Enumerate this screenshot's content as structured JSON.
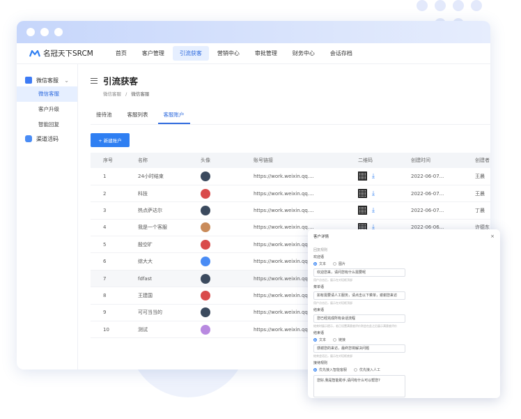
{
  "colors": {
    "accent": "#2f7ff2",
    "nav_active_bg": "#e6efff",
    "titlebar": "#c6d6fb"
  },
  "app": {
    "logo_text": "名冠天下SRCM"
  },
  "topnav": [
    {
      "label": "首页"
    },
    {
      "label": "客户管理"
    },
    {
      "label": "引流获客",
      "active": true
    },
    {
      "label": "营销中心"
    },
    {
      "label": "审批管理"
    },
    {
      "label": "财务中心"
    },
    {
      "label": "会话存档"
    }
  ],
  "sidebar": {
    "group1": {
      "label": "微信客服",
      "icon": "chat-icon"
    },
    "items": [
      {
        "label": "微信客服",
        "active": true
      },
      {
        "label": "客户升级"
      },
      {
        "label": "智能回复"
      }
    ],
    "group2": {
      "label": "渠道活码",
      "icon": "person-icon"
    }
  },
  "page": {
    "title": "引流获客",
    "breadcrumb": {
      "root": "微信客服",
      "sep": "/",
      "current": "微信客服"
    },
    "tabs": [
      {
        "label": "接待池"
      },
      {
        "label": "客服列表"
      },
      {
        "label": "客服账户",
        "active": true
      }
    ],
    "add_button": "+ 新建账户"
  },
  "table": {
    "headers": [
      "序号",
      "名称",
      "头像",
      "账号链接",
      "二维码",
      "创建时间",
      "创建者"
    ],
    "rows": [
      {
        "no": "1",
        "name": "24小时结束",
        "avatar": "#3b4a5e",
        "link": "https://work.weixin.qq....",
        "created": "2022-06-07...",
        "creator": "王晨"
      },
      {
        "no": "2",
        "name": "科技",
        "avatar": "#d94b4b",
        "link": "https://work.weixin.qq....",
        "created": "2022-06-07...",
        "creator": "王晨"
      },
      {
        "no": "3",
        "name": "热点萨达尔",
        "avatar": "#3b4a5e",
        "link": "https://work.weixin.qq....",
        "created": "2022-06-07...",
        "creator": "丁晨"
      },
      {
        "no": "4",
        "name": "我是一个客服",
        "avatar": "#c98b5a",
        "link": "https://work.weixin.qq....",
        "created": "2022-06-06...",
        "creator": "许德东"
      },
      {
        "no": "5",
        "name": "殷空旷",
        "avatar": "#d94b4b",
        "link": "https://work.weixin.qq....",
        "created": "",
        "creator": ""
      },
      {
        "no": "6",
        "name": "综大大",
        "avatar": "#4a8cf5",
        "link": "https://work.weixin.qq....",
        "created": "",
        "creator": ""
      },
      {
        "no": "7",
        "name": "fdfast",
        "avatar": "#3b4a5e",
        "link": "https://work.weixin.qq....",
        "created": "",
        "creator": "",
        "highlight": true
      },
      {
        "no": "8",
        "name": "王建国",
        "avatar": "#d94b4b",
        "link": "https://work.weixin.qq....",
        "created": "",
        "creator": ""
      },
      {
        "no": "9",
        "name": "可可当当的",
        "avatar": "#3b4a5e",
        "link": "https://work.weixin.qq....",
        "created": "",
        "creator": ""
      },
      {
        "no": "10",
        "name": "测试",
        "avatar": "#b889e0",
        "link": "https://work.weixin.qq....",
        "created": "",
        "creator": ""
      }
    ]
  },
  "popup": {
    "title": "客户详情",
    "close": "×",
    "section": "回复规则",
    "label1": "欢迎语",
    "radio_text": "文本",
    "radio_image": "图片",
    "input1": "欢迎您来，请问您有什么需要呢",
    "hint1": "用户点击后，展示在对话框顶部",
    "label2": "菜单语",
    "input2": "如有需要请人工服务，请点击以下菜单，谢谢您来访",
    "hint2": "用户点击后，展示在对话框顶部",
    "label3": "结束语",
    "input3": "您已经完成所有会话流程",
    "hint3": "结束时展示提示，若已设置满意度评价则会在此之后展示满意度评价",
    "label4": "结束语",
    "radio_text2": "文本",
    "radio_link": "链接",
    "input4": "感谢您的来访，最终您将解决问题",
    "hint4": "结束会话后，展示在对话框底部",
    "label5": "接待规则",
    "rule_a": "优先接入智能客服",
    "rule_b": "优先接入人工",
    "textarea": "您好,我是智能助手,请问有什么可以帮您?"
  }
}
